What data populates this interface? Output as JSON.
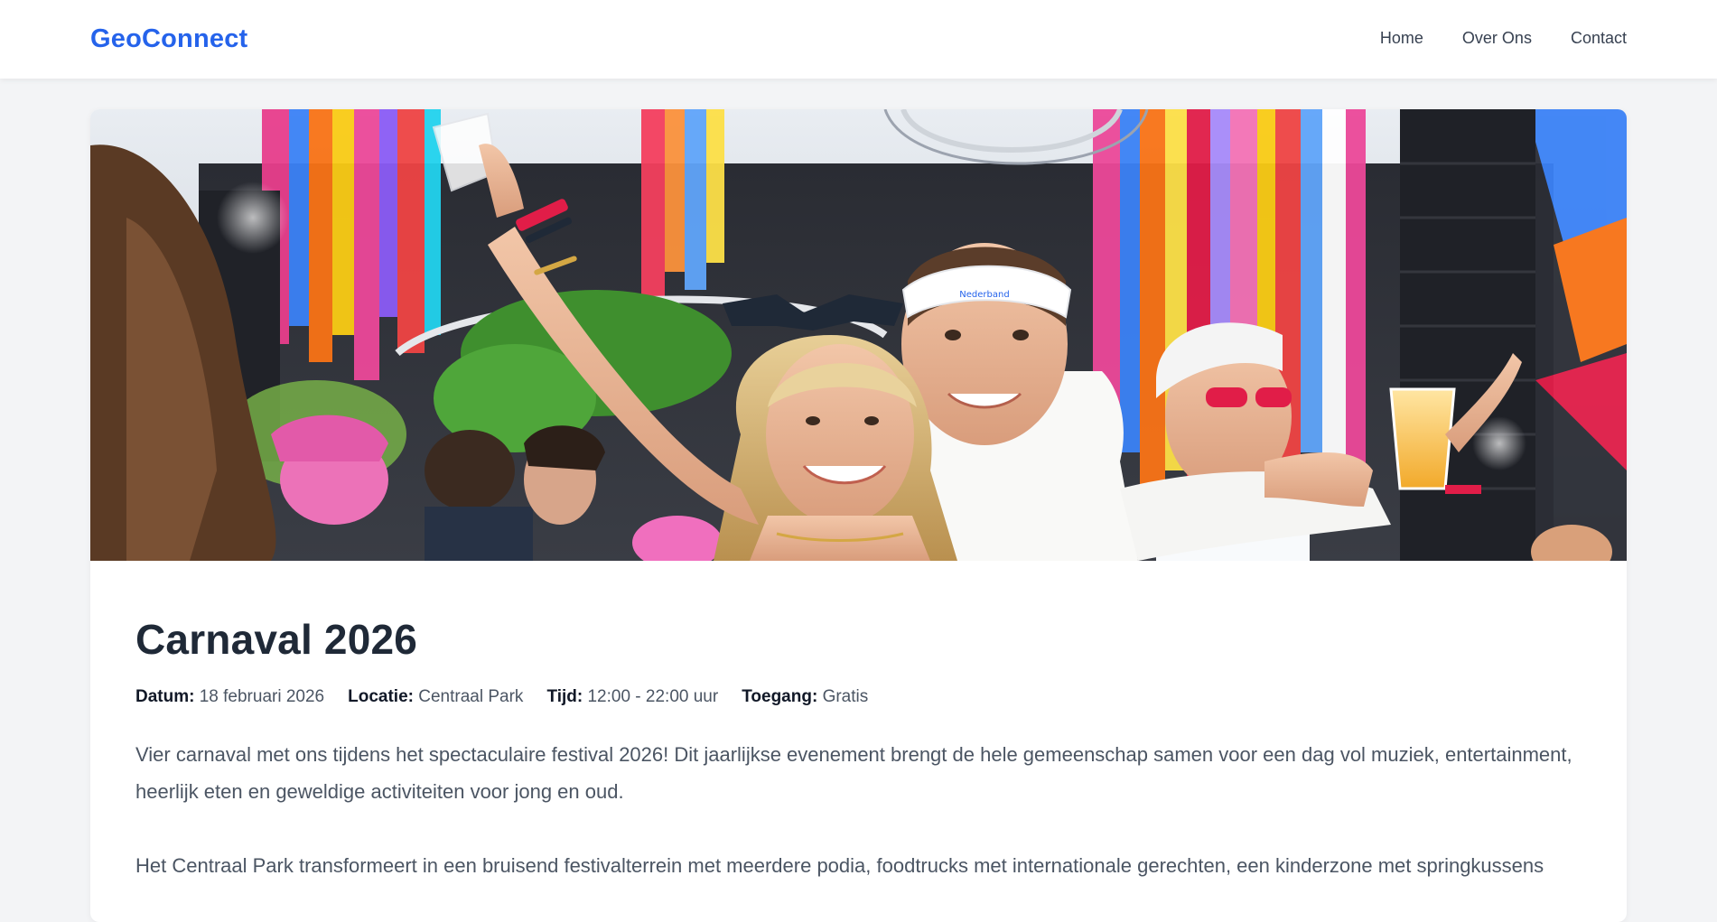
{
  "nav": {
    "brand": "GeoConnect",
    "links": [
      {
        "label": "Home"
      },
      {
        "label": "Over Ons"
      },
      {
        "label": "Contact"
      }
    ]
  },
  "event": {
    "title": "Carnaval 2026",
    "meta": [
      {
        "label": "Datum:",
        "value": "18 februari 2026"
      },
      {
        "label": "Locatie:",
        "value": "Centraal Park"
      },
      {
        "label": "Tijd:",
        "value": "12:00 - 22:00 uur"
      },
      {
        "label": "Toegang:",
        "value": "Gratis"
      }
    ],
    "paragraphs": [
      "Vier carnaval met ons tijdens het spectaculaire festival 2026! Dit jaarlijkse evenement brengt de hele gemeenschap samen voor een dag vol muziek, entertainment, heerlijk eten en geweldige activiteiten voor jong en oud.",
      "Het Centraal Park transformeert in een bruisend festivalterrein met meerdere podia, foodtrucks met internationale gerechten, een kinderzone met springkussens"
    ],
    "headband_text": "Nederband"
  },
  "colors": {
    "brand": "#2563eb",
    "background": "#f3f4f6",
    "card": "#ffffff",
    "title": "#1f2937",
    "text": "#4b5563"
  }
}
